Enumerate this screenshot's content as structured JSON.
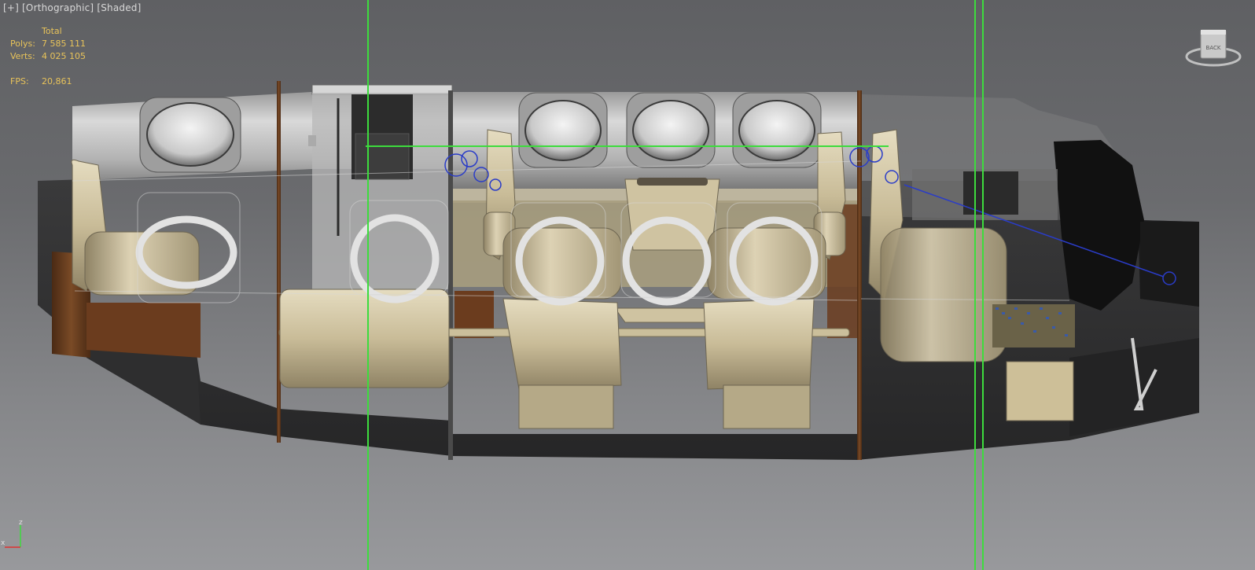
{
  "viewport": {
    "menu": "[+]",
    "view": "[Orthographic]",
    "shading": "[Shaded]"
  },
  "stats": {
    "header": "Total",
    "polys_label": "Polys:",
    "polys_value": "7 585 111",
    "verts_label": "Verts:",
    "verts_value": "4 025 105",
    "fps_label": "FPS:",
    "fps_value": "20,861"
  },
  "viewcube": {
    "face_label": "BACK",
    "top_label": ""
  },
  "axis": {
    "x_label": "x",
    "z_label": "z"
  },
  "colors": {
    "background_top": "#5f6063",
    "background_bottom": "#98999c",
    "stats_text": "#e8c35a",
    "guide_line": "#3ddc3d",
    "helper_blue": "#2a3cc8",
    "leather": "#cfc3a1",
    "wood": "#6b3c1e",
    "hull_dark": "#2b2b2c"
  }
}
